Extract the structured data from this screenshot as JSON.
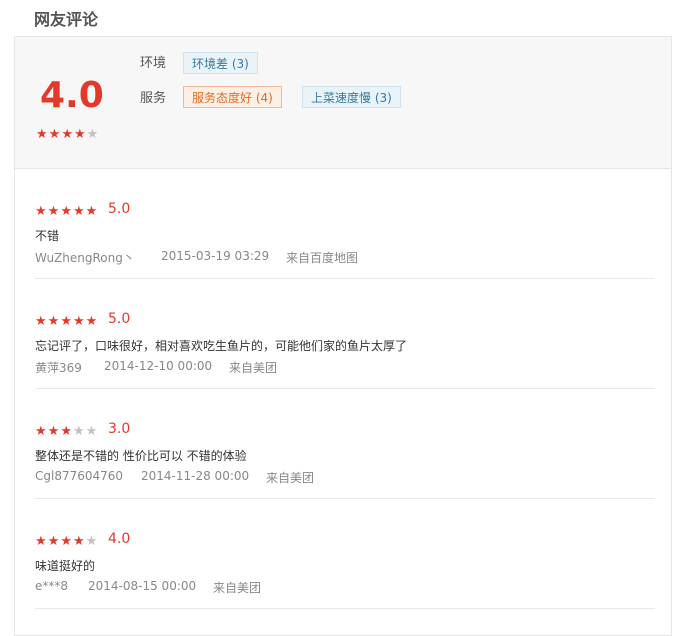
{
  "section": {
    "title": "网友评论"
  },
  "summary": {
    "score": "4.0",
    "stars": 4,
    "categories": [
      {
        "label": "环境",
        "tags": [
          {
            "text": "环境差 (3)",
            "sentiment": "neutral"
          }
        ]
      },
      {
        "label": "服务",
        "tags": [
          {
            "text": "服务态度好 (4)",
            "sentiment": "positive"
          },
          {
            "text": "上菜速度慢 (3)",
            "sentiment": "neutral"
          }
        ]
      }
    ]
  },
  "colors": {
    "accent": "#e4392a",
    "positive_tag": "#e46d21",
    "neutral_tag": "#357a9f",
    "star_off": "#c2c2c2"
  },
  "reviews": [
    {
      "stars": 5,
      "rating": "5.0",
      "text": "不错",
      "author": "WuZhengRong丶",
      "date": "2015-03-19 03:29",
      "source": "来自百度地图"
    },
    {
      "stars": 5,
      "rating": "5.0",
      "text": "忘记评了，口味很好，相对喜欢吃生鱼片的，可能他们家的鱼片太厚了",
      "author": "黄萍369",
      "date": "2014-12-10 00:00",
      "source": "来自美团"
    },
    {
      "stars": 3,
      "rating": "3.0",
      "text": "整体还是不错的 性价比可以 不错的体验",
      "author": "Cgl877604760",
      "date": "2014-11-28 00:00",
      "source": "来自美团"
    },
    {
      "stars": 4,
      "rating": "4.0",
      "text": "味道挺好的",
      "author": "e***8",
      "date": "2014-08-15 00:00",
      "source": "来自美团"
    }
  ]
}
